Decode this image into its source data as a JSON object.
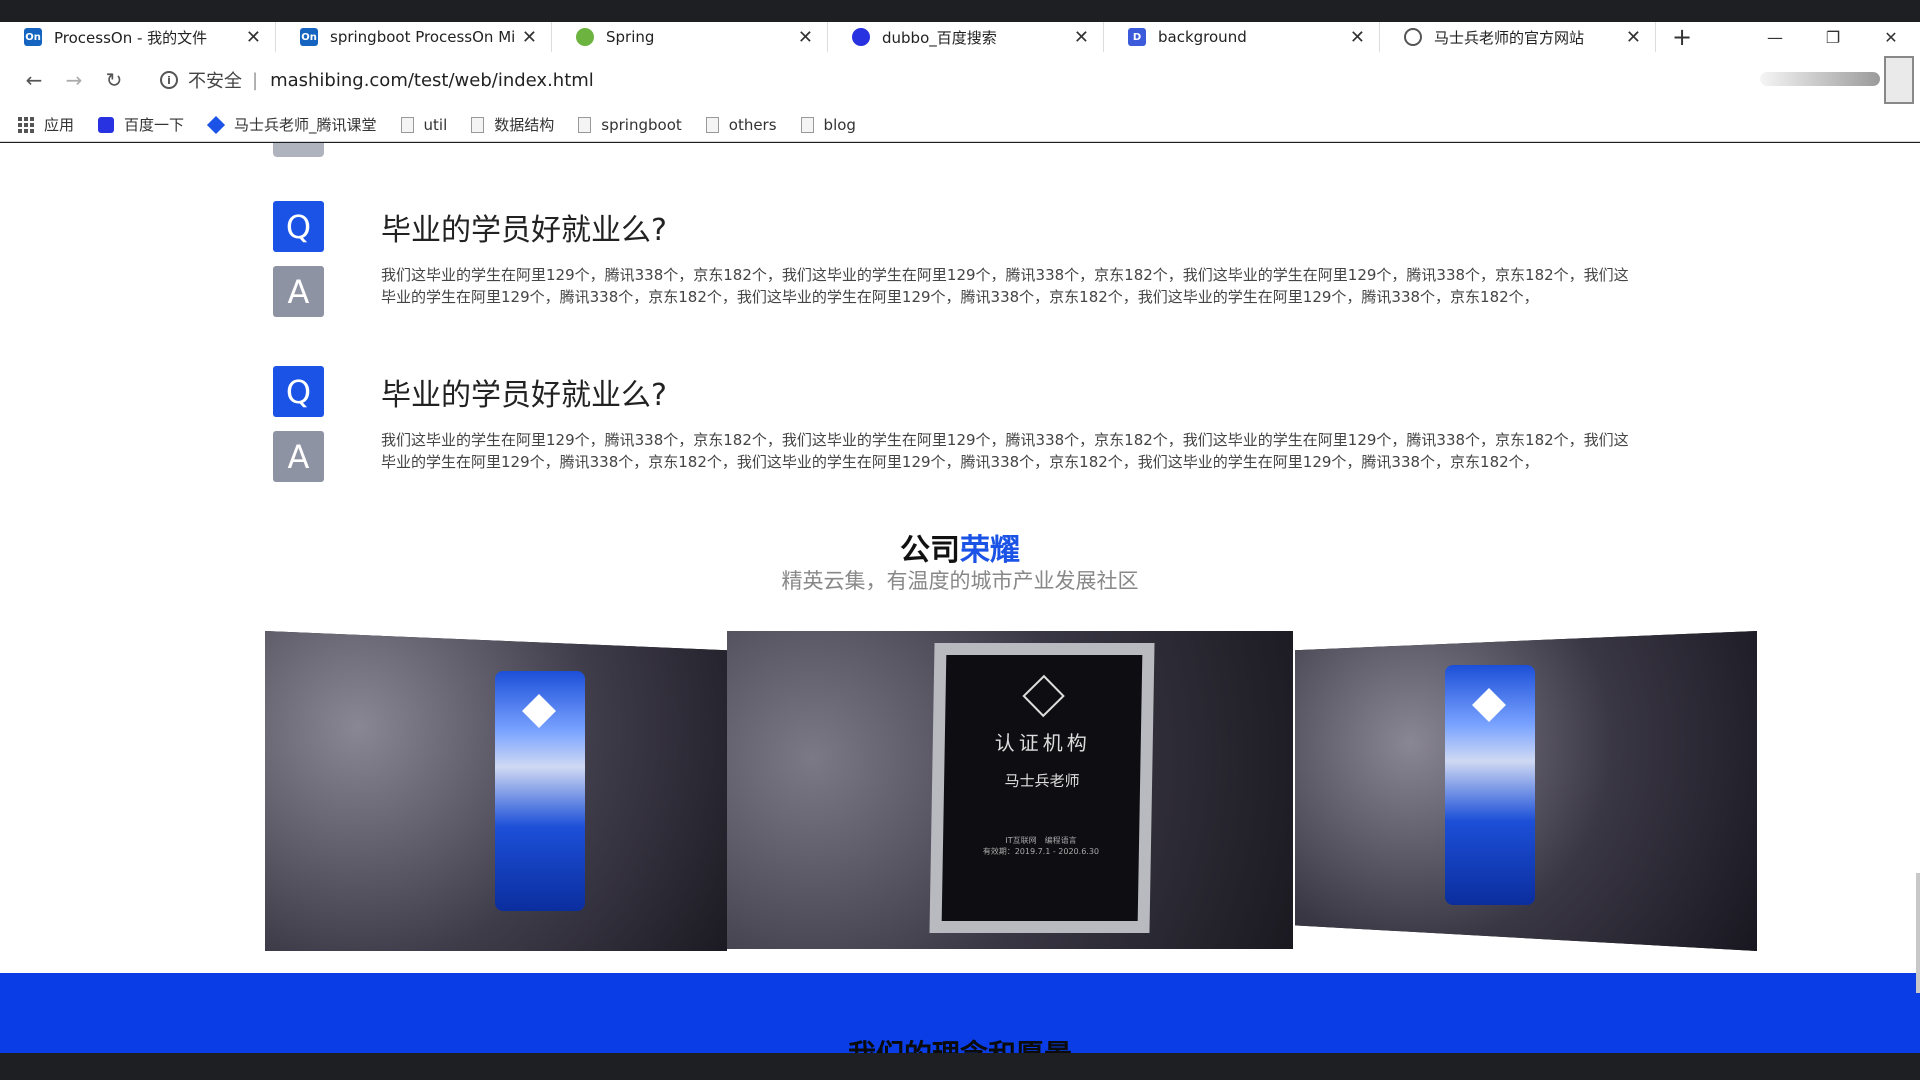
{
  "browser": {
    "tabs": [
      {
        "title": "ProcessOn - 我的文件",
        "favicon": "On",
        "color": "#1565c0"
      },
      {
        "title": "springboot ProcessOn Min",
        "favicon": "On",
        "color": "#1565c0"
      },
      {
        "title": "Spring",
        "favicon": "leaf-icon",
        "color": "#6db33f"
      },
      {
        "title": "dubbo_百度搜索",
        "favicon": "paw-icon",
        "color": "#2932e1"
      },
      {
        "title": "background",
        "favicon": "D",
        "color": "#3b5bdb"
      },
      {
        "title": "马士兵老师的官方网站",
        "favicon": "globe-icon",
        "color": "#555555"
      }
    ],
    "new_tab": "+",
    "address": {
      "insecure_label": "不安全",
      "url": "mashibing.com/test/web/index.html"
    },
    "bookmarks": [
      {
        "label": "应用",
        "icon": "apps-grid-icon"
      },
      {
        "label": "百度一下",
        "icon": "baidu-icon"
      },
      {
        "label": "马士兵老师_腾讯课堂",
        "icon": "tencent-icon"
      },
      {
        "label": "util",
        "icon": "page-icon"
      },
      {
        "label": "数据结构",
        "icon": "page-icon"
      },
      {
        "label": "springboot",
        "icon": "page-icon"
      },
      {
        "label": "others",
        "icon": "page-icon"
      },
      {
        "label": "blog",
        "icon": "page-icon"
      }
    ]
  },
  "faq": [
    {
      "q_badge": "Q",
      "a_badge": "A",
      "question": "毕业的学员好就业么?",
      "answer": "我们这毕业的学生在阿里129个，腾讯338个，京东182个，我们这毕业的学生在阿里129个，腾讯338个，京东182个，我们这毕业的学生在阿里129个，腾讯338个，京东182个，我们这毕业的学生在阿里129个，腾讯338个，京东182个，我们这毕业的学生在阿里129个，腾讯338个，京东182个，我们这毕业的学生在阿里129个，腾讯338个，京东182个，"
    },
    {
      "q_badge": "Q",
      "a_badge": "A",
      "question": "毕业的学员好就业么?",
      "answer": "我们这毕业的学生在阿里129个，腾讯338个，京东182个，我们这毕业的学生在阿里129个，腾讯338个，京东182个，我们这毕业的学生在阿里129个，腾讯338个，京东182个，我们这毕业的学生在阿里129个，腾讯338个，京东182个，我们这毕业的学生在阿里129个，腾讯338个，京东182个，我们这毕业的学生在阿里129个，腾讯338个，京东182个，"
    }
  ],
  "honor": {
    "title_plain": "公司",
    "title_accent": "荣耀",
    "subtitle": "精英云集，有温度的城市产业发展社区",
    "plaque": {
      "title": "认证机构",
      "name": "马士兵老师",
      "line1": "IT互联网　编程语言",
      "line2": "有效期：2019.7.1 - 2020.6.30"
    }
  },
  "next_section": {
    "title": "我们的理念和愿景"
  },
  "colors": {
    "accent": "#1a53e6",
    "band": "#0a3de6",
    "a_badge": "#8e93a3"
  }
}
